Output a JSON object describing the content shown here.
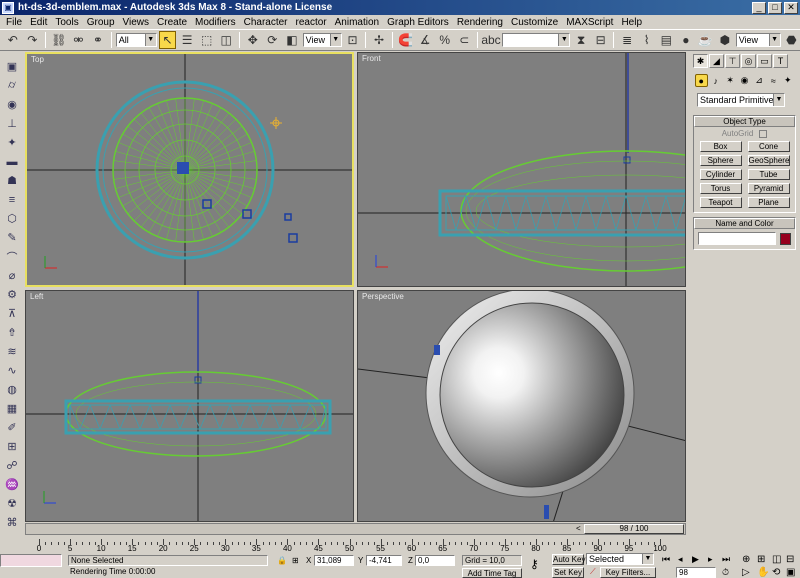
{
  "window": {
    "title": "ht-ds-3d-emblem.max - Autodesk 3ds Max 8 - Stand-alone License",
    "minimize": "_",
    "maximize": "□",
    "close": "✕"
  },
  "menu": [
    "File",
    "Edit",
    "Tools",
    "Group",
    "Views",
    "Create",
    "Modifiers",
    "Character",
    "reactor",
    "Animation",
    "Graph Editors",
    "Rendering",
    "Customize",
    "MAXScript",
    "Help"
  ],
  "toolbar": {
    "selection_filter": "All",
    "ref_coord": "View",
    "named_selection": "",
    "view_right": "View"
  },
  "viewports": {
    "top": "Top",
    "front": "Front",
    "left": "Left",
    "perspective": "Perspective"
  },
  "command_panel": {
    "category": "Standard Primitives",
    "object_type_title": "Object Type",
    "autogrid": "AutoGrid",
    "objects": [
      "Box",
      "Cone",
      "Sphere",
      "GeoSphere",
      "Cylinder",
      "Tube",
      "Torus",
      "Pyramid",
      "Teapot",
      "Plane"
    ],
    "name_color_title": "Name and Color",
    "color": "#96001e"
  },
  "time": {
    "slider_label": "98 / 100",
    "frame_ticks": [
      "0",
      "5",
      "10",
      "15",
      "20",
      "25",
      "30",
      "35",
      "40",
      "45",
      "50",
      "55",
      "60",
      "65",
      "70",
      "75",
      "80",
      "85",
      "90",
      "95",
      "100"
    ]
  },
  "status": {
    "selection": "None Selected",
    "render_time": "Rendering Time  0:00:00",
    "x_label": "X",
    "x_value": "31,089",
    "y_label": "Y",
    "y_value": "-4,741",
    "z_label": "Z",
    "z_value": "0,0",
    "grid": "Grid = 10,0",
    "add_time_tag": "Add Time Tag",
    "auto_key": "Auto Key",
    "set_key": "Set Key",
    "key_mode": "Selected",
    "key_filters": "Key Filters...",
    "current_frame": "98"
  }
}
